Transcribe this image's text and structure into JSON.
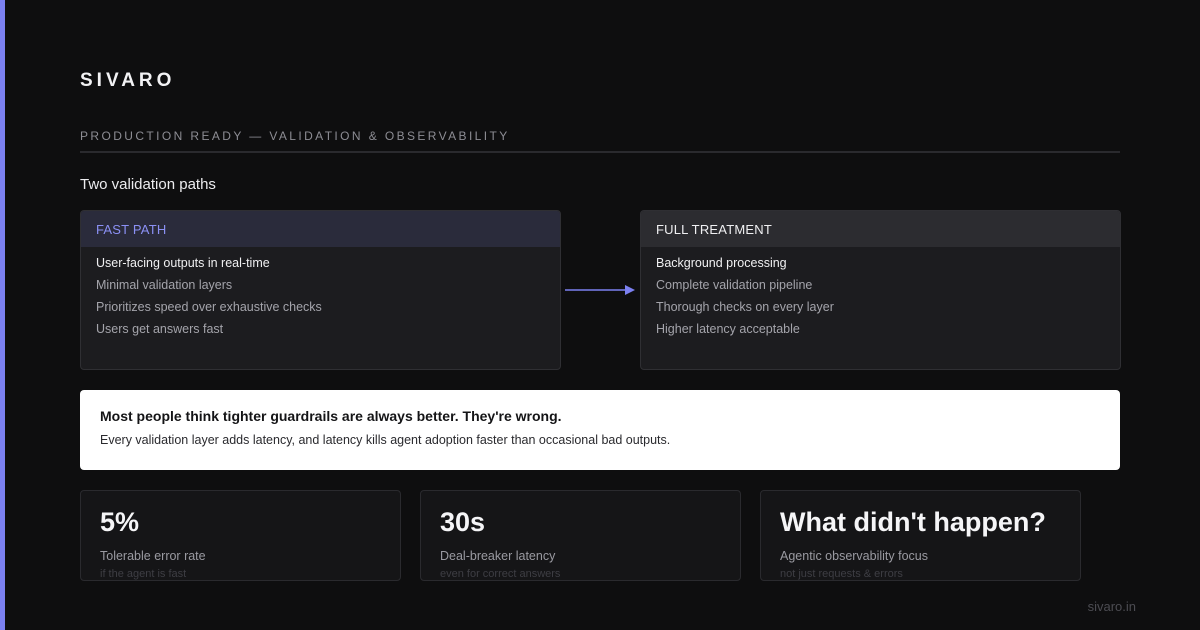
{
  "brand": "SIVARO",
  "header": {
    "subtitle": "PRODUCTION READY — VALIDATION & OBSERVABILITY"
  },
  "section_title": "Two validation paths",
  "fast_path": {
    "title": "FAST PATH",
    "items": [
      "User-facing outputs in real-time",
      "Minimal validation layers",
      "Prioritizes speed over exhaustive checks",
      "Users get answers fast"
    ]
  },
  "full_treatment": {
    "title": "FULL TREATMENT",
    "items": [
      "Background processing",
      "Complete validation pipeline",
      "Thorough checks on every layer",
      "Higher latency acceptable"
    ]
  },
  "callout": {
    "title": "Most people think tighter guardrails are always better. They're wrong.",
    "body": "Every validation layer adds latency, and latency kills agent adoption faster than occasional bad outputs."
  },
  "stats": [
    {
      "value": "5%",
      "label": "Tolerable error rate",
      "note": "if the agent is fast"
    },
    {
      "value": "30s",
      "label": "Deal-breaker latency",
      "note": "even for correct answers"
    },
    {
      "value": "What didn't happen?",
      "label": "Agentic observability focus",
      "note": "not just requests & errors"
    }
  ],
  "footer": "sivaro.in",
  "icons": {
    "arrow": "arrow-right-icon"
  },
  "colors": {
    "accent": "#7b80f0",
    "background": "#0e0e0f",
    "callout_bg": "#ffffff"
  }
}
